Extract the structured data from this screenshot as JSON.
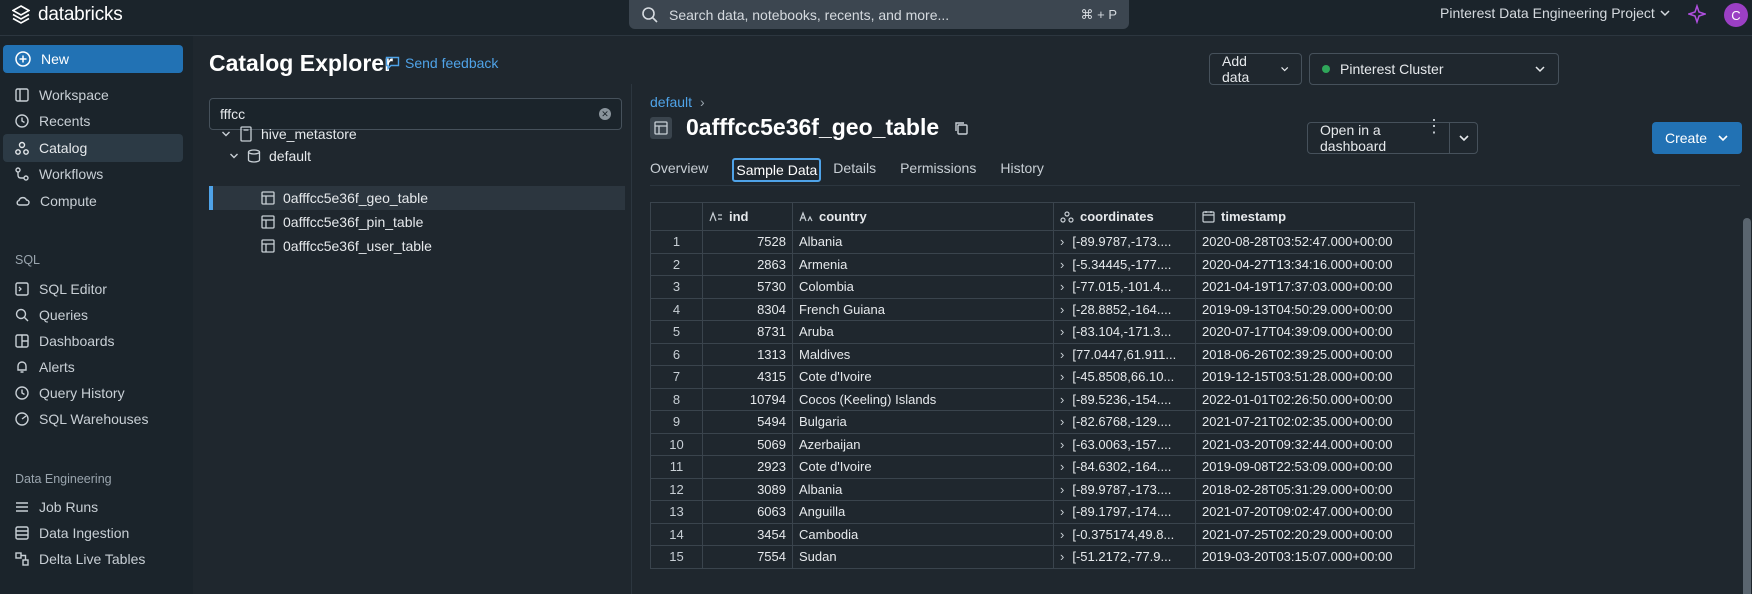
{
  "topbar": {
    "logo_text": "databricks",
    "search_placeholder": "Search data, notebooks, recents, and more...",
    "search_shortcut": "⌘ + P",
    "workspace_name": "Pinterest Data Engineering Project",
    "avatar_initial": "C"
  },
  "sidebar": {
    "new_label": "New",
    "items": [
      {
        "label": "Workspace",
        "icon": "workspace-icon"
      },
      {
        "label": "Recents",
        "icon": "clock-icon"
      },
      {
        "label": "Catalog",
        "icon": "catalog-icon"
      },
      {
        "label": "Workflows",
        "icon": "workflows-icon"
      },
      {
        "label": "Compute",
        "icon": "cloud-icon"
      }
    ],
    "sql_section": "SQL",
    "sql_items": [
      {
        "label": "SQL Editor",
        "icon": "editor-icon"
      },
      {
        "label": "Queries",
        "icon": "query-icon"
      },
      {
        "label": "Dashboards",
        "icon": "dashboard-icon"
      },
      {
        "label": "Alerts",
        "icon": "bell-icon"
      },
      {
        "label": "Query History",
        "icon": "history-icon"
      },
      {
        "label": "SQL Warehouses",
        "icon": "warehouse-icon"
      }
    ],
    "de_section": "Data Engineering",
    "de_items": [
      {
        "label": "Job Runs",
        "icon": "jobs-icon"
      },
      {
        "label": "Data Ingestion",
        "icon": "ingestion-icon"
      },
      {
        "label": "Delta Live Tables",
        "icon": "pipeline-icon"
      }
    ]
  },
  "main": {
    "title": "Catalog Explorer",
    "feedback": "Send feedback",
    "add_data": "Add data",
    "cluster": "Pinterest Cluster",
    "filter_value": "fffcc",
    "tree": {
      "metastore": "hive_metastore",
      "schema": "default",
      "tables": [
        "0afffcc5e36f_geo_table",
        "0afffcc5e36f_pin_table",
        "0afffcc5e36f_user_table"
      ]
    },
    "breadcrumb": "default",
    "breadcrumb_sep": "›",
    "table_title": "0afffcc5e36f_geo_table",
    "open_dashboard": "Open in a dashboard",
    "create": "Create",
    "tabs": [
      "Overview",
      "Sample Data",
      "Details",
      "Permissions",
      "History"
    ],
    "columns": [
      "ind",
      "country",
      "coordinates",
      "timestamp"
    ],
    "rows": [
      [
        "1",
        "7528",
        "Albania",
        "[-89.9787,-173....",
        "2020-08-28T03:52:47.000+00:00"
      ],
      [
        "2",
        "2863",
        "Armenia",
        "[-5.34445,-177....",
        "2020-04-27T13:34:16.000+00:00"
      ],
      [
        "3",
        "5730",
        "Colombia",
        "[-77.015,-101.4...",
        "2021-04-19T17:37:03.000+00:00"
      ],
      [
        "4",
        "8304",
        "French Guiana",
        "[-28.8852,-164....",
        "2019-09-13T04:50:29.000+00:00"
      ],
      [
        "5",
        "8731",
        "Aruba",
        "[-83.104,-171.3...",
        "2020-07-17T04:39:09.000+00:00"
      ],
      [
        "6",
        "1313",
        "Maldives",
        "[77.0447,61.911...",
        "2018-06-26T02:39:25.000+00:00"
      ],
      [
        "7",
        "4315",
        "Cote d'Ivoire",
        "[-45.8508,66.10...",
        "2019-12-15T03:51:28.000+00:00"
      ],
      [
        "8",
        "10794",
        "Cocos (Keeling) Islands",
        "[-89.5236,-154....",
        "2022-01-01T02:26:50.000+00:00"
      ],
      [
        "9",
        "5494",
        "Bulgaria",
        "[-82.6768,-129....",
        "2021-07-21T02:02:35.000+00:00"
      ],
      [
        "10",
        "5069",
        "Azerbaijan",
        "[-63.0063,-157....",
        "2021-03-20T09:32:44.000+00:00"
      ],
      [
        "11",
        "2923",
        "Cote d'Ivoire",
        "[-84.6302,-164....",
        "2019-09-08T22:53:09.000+00:00"
      ],
      [
        "12",
        "3089",
        "Albania",
        "[-89.9787,-173....",
        "2018-02-28T05:31:29.000+00:00"
      ],
      [
        "13",
        "6063",
        "Anguilla",
        "[-89.1797,-174....",
        "2021-07-20T09:02:47.000+00:00"
      ],
      [
        "14",
        "3454",
        "Cambodia",
        "[-0.375174,49.8...",
        "2021-07-25T02:20:29.000+00:00"
      ],
      [
        "15",
        "7554",
        "Sudan",
        "[-51.2172,-77.9...",
        "2019-03-20T03:15:07.000+00:00"
      ]
    ]
  },
  "colors": {
    "accent": "#2272b4",
    "link": "#4fa3e8",
    "cluster_status": "#2fa65a"
  }
}
